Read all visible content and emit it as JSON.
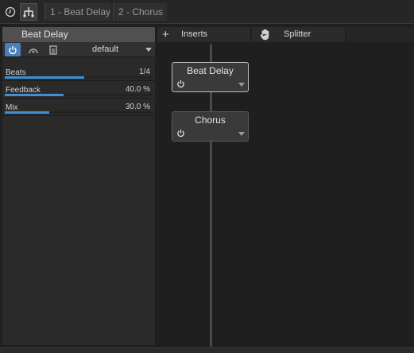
{
  "tabbar": {
    "tabs": [
      {
        "label": "1 - Beat Delay"
      },
      {
        "label": "2 - Chorus"
      }
    ]
  },
  "device": {
    "title": "Beat Delay",
    "preset": "default",
    "params": [
      {
        "name": "Beats",
        "value": "1/4",
        "fill": 0.54
      },
      {
        "name": "Feedback",
        "value": "40.0 %",
        "fill": 0.4
      },
      {
        "name": "Mix",
        "value": "30.0 %",
        "fill": 0.3
      }
    ]
  },
  "routing": {
    "inserts_label": "Inserts",
    "splitter_label": "Splitter",
    "nodes": [
      {
        "name": "Beat Delay"
      },
      {
        "name": "Chorus"
      }
    ]
  },
  "colors": {
    "accent": "#3f8ed8",
    "power_active": "#4a7fbc"
  }
}
